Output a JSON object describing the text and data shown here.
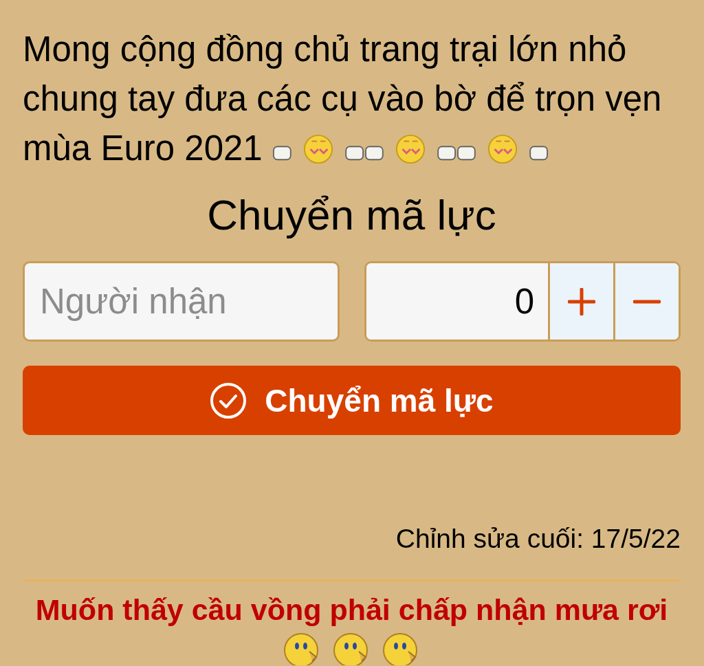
{
  "post": {
    "text": "Mong cộng đồng chủ trang trại lớn nhỏ chung tay đưa các cụ vào bờ để trọn vẹn mùa Euro 2021"
  },
  "transfer": {
    "title": "Chuyển mã lực",
    "recipient": {
      "placeholder": "Người nhận"
    },
    "amount": {
      "value": "0"
    },
    "submit": "Chuyển mã lực"
  },
  "last_edited": "Chỉnh sửa cuối: 17/5/22",
  "signature": {
    "text": "Muốn thấy cầu vồng phải chấp nhận mưa rơi"
  }
}
